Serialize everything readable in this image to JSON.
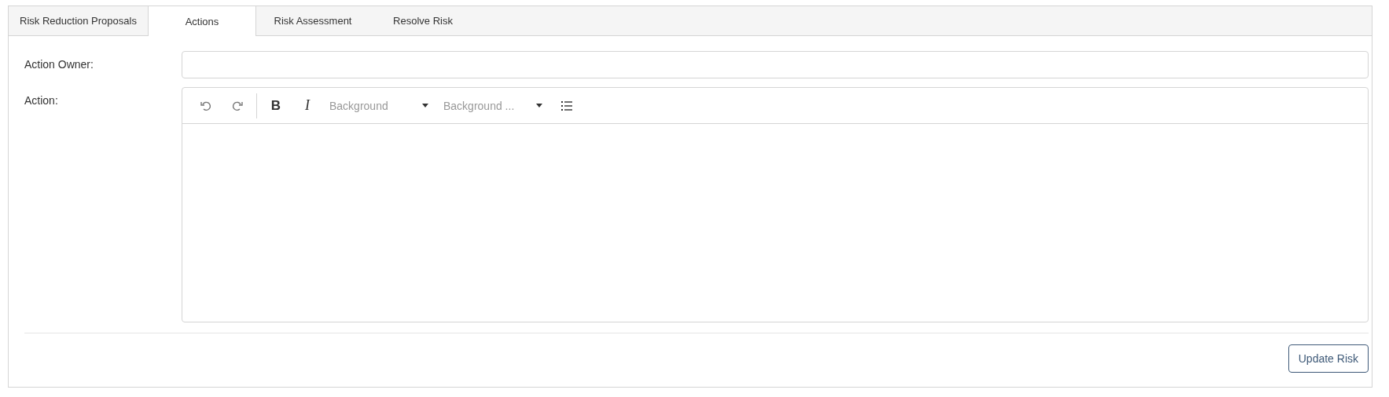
{
  "tabs": [
    {
      "label": "Risk Reduction Proposals",
      "selected": false
    },
    {
      "label": "Actions",
      "selected": true
    },
    {
      "label": "Risk Assessment",
      "selected": false
    },
    {
      "label": "Resolve Risk",
      "selected": false
    }
  ],
  "form": {
    "fields": [
      {
        "kind": "text",
        "label": "Action Owner:"
      },
      {
        "kind": "editor",
        "label": "Action:",
        "toolbar": [
          {
            "kind": "undo"
          },
          {
            "kind": "redo"
          },
          {
            "kind": "separator"
          },
          {
            "kind": "bold",
            "label": "B"
          },
          {
            "kind": "italic",
            "label": "I"
          },
          {
            "kind": "dropdown",
            "placeholder": "Background"
          },
          {
            "kind": "dropdown",
            "placeholder": "Background ..."
          },
          {
            "kind": "list"
          }
        ]
      }
    ]
  },
  "button": {
    "label": "Update Risk"
  }
}
